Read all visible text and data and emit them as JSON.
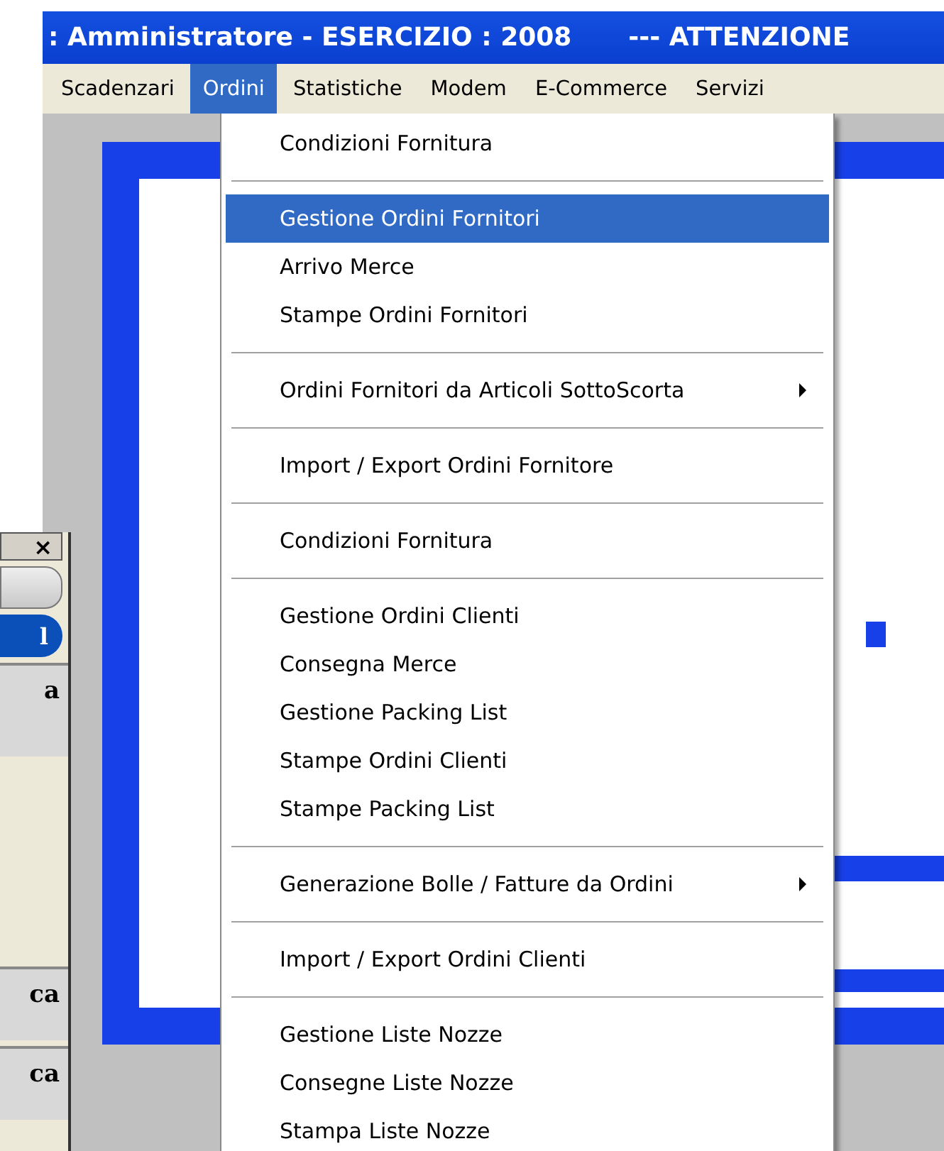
{
  "title_bar": {
    "title": ": Amministratore - ESERCIZIO : 2008",
    "notice": "--- ATTENZIONE"
  },
  "menu_bar": [
    {
      "label": "Scadenzari",
      "selected": false
    },
    {
      "label": "Ordini",
      "selected": true
    },
    {
      "label": "Statistiche",
      "selected": false
    },
    {
      "label": "Modem",
      "selected": false
    },
    {
      "label": "E-Commerce",
      "selected": false
    },
    {
      "label": "Servizi",
      "selected": false
    }
  ],
  "dropdown": [
    {
      "kind": "item",
      "label": "Condizioni Fornitura",
      "selected": false
    },
    {
      "kind": "separator"
    },
    {
      "kind": "item",
      "label": "Gestione Ordini Fornitori",
      "selected": true
    },
    {
      "kind": "item",
      "label": "Arrivo Merce",
      "selected": false
    },
    {
      "kind": "item",
      "label": "Stampe Ordini Fornitori",
      "selected": false
    },
    {
      "kind": "separator"
    },
    {
      "kind": "submenu",
      "label": "Ordini Fornitori da Articoli SottoScorta",
      "selected": false
    },
    {
      "kind": "separator"
    },
    {
      "kind": "item",
      "label": "Import / Export Ordini Fornitore",
      "selected": false
    },
    {
      "kind": "separator"
    },
    {
      "kind": "item",
      "label": "Condizioni Fornitura",
      "selected": false
    },
    {
      "kind": "separator"
    },
    {
      "kind": "item",
      "label": "Gestione Ordini Clienti",
      "selected": false
    },
    {
      "kind": "item",
      "label": "Consegna Merce",
      "selected": false
    },
    {
      "kind": "item",
      "label": "Gestione Packing List",
      "selected": false
    },
    {
      "kind": "item",
      "label": "Stampe Ordini Clienti",
      "selected": false
    },
    {
      "kind": "item",
      "label": "Stampe Packing List",
      "selected": false
    },
    {
      "kind": "separator"
    },
    {
      "kind": "submenu",
      "label": "Generazione Bolle / Fatture da Ordini",
      "selected": false
    },
    {
      "kind": "separator"
    },
    {
      "kind": "item",
      "label": "Import / Export Ordini Clienti",
      "selected": false
    },
    {
      "kind": "separator"
    },
    {
      "kind": "item",
      "label": "Gestione Liste Nozze",
      "selected": false
    },
    {
      "kind": "item",
      "label": "Consegne Liste Nozze",
      "selected": false
    },
    {
      "kind": "item",
      "label": "Stampa Liste Nozze",
      "selected": false
    }
  ],
  "side_window": {
    "close": "×",
    "tab": "l",
    "rows": [
      {
        "text": "a"
      },
      {
        "text": "ca"
      },
      {
        "text": "ca"
      }
    ]
  }
}
